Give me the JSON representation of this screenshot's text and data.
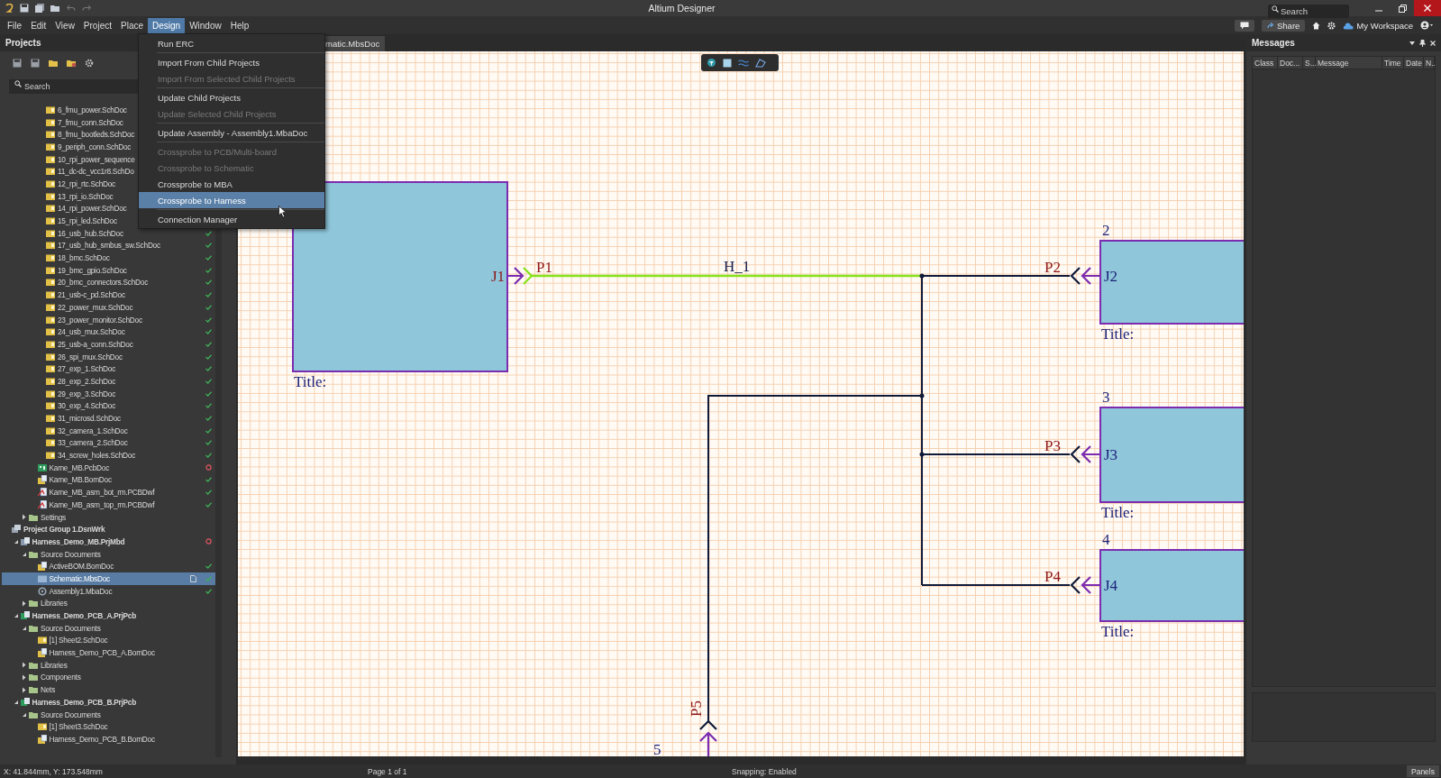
{
  "title_bar": {
    "title": "Altium Designer",
    "search_placeholder": "Search"
  },
  "menu_bar": {
    "menus": [
      {
        "label": "File",
        "selected": false
      },
      {
        "label": "Edit",
        "selected": false
      },
      {
        "label": "View",
        "selected": false
      },
      {
        "label": "Project",
        "selected": false
      },
      {
        "label": "Place",
        "selected": false
      },
      {
        "label": "Design",
        "selected": true
      },
      {
        "label": "Window",
        "selected": false
      },
      {
        "label": "Help",
        "selected": false
      }
    ],
    "share": "Share",
    "workspace": "My Workspace"
  },
  "design_menu": {
    "groups": [
      {
        "items": [
          {
            "label": "Run ERC",
            "disabled": false,
            "selected": false
          }
        ]
      },
      {
        "items": [
          {
            "label": "Import From Child Projects",
            "disabled": false,
            "selected": false
          },
          {
            "label": "Import From Selected Child Projects",
            "disabled": true,
            "selected": false
          }
        ]
      },
      {
        "items": [
          {
            "label": "Update Child Projects",
            "disabled": false,
            "selected": false
          },
          {
            "label": "Update Selected Child Projects",
            "disabled": true,
            "selected": false
          }
        ]
      },
      {
        "items": [
          {
            "label": "Update Assembly - Assembly1.MbaDoc",
            "disabled": false,
            "selected": false
          }
        ]
      },
      {
        "items": [
          {
            "label": "Crossprobe to PCB/Multi-board",
            "disabled": true,
            "selected": false
          },
          {
            "label": "Crossprobe to Schematic",
            "disabled": true,
            "selected": false
          },
          {
            "label": "Crossprobe to MBA",
            "disabled": false,
            "selected": false
          },
          {
            "label": "Crossprobe to Harness",
            "disabled": false,
            "selected": true
          }
        ]
      },
      {
        "items": [
          {
            "label": "Connection Manager",
            "disabled": false,
            "selected": false
          }
        ]
      }
    ]
  },
  "projects_panel": {
    "title": "Projects",
    "search_placeholder": "Search",
    "tree": [
      {
        "children": [
          {
            "children": [
              {
                "children": [
                  {
                    "children": [
                      {
                        "label": "6_fmu_power.SchDoc",
                        "kind": "sch",
                        "selected": false
                      },
                      {
                        "label": "7_fmu_conn.SchDoc",
                        "kind": "sch",
                        "selected": false
                      },
                      {
                        "label": "8_fmu_bootleds.SchDoc",
                        "kind": "sch",
                        "selected": false
                      },
                      {
                        "label": "9_periph_conn.SchDoc",
                        "kind": "sch",
                        "selected": false
                      },
                      {
                        "label": "10_rpi_power_sequence",
                        "kind": "sch",
                        "selected": false
                      },
                      {
                        "label": "11_dc-dc_vcc1r8.SchDo",
                        "kind": "sch",
                        "selected": false
                      },
                      {
                        "label": "12_rpi_rtc.SchDoc",
                        "kind": "sch",
                        "selected": false
                      },
                      {
                        "label": "13_rpi_io.SchDoc",
                        "kind": "sch",
                        "selected": false
                      },
                      {
                        "label": "14_rpi_power.SchDoc",
                        "kind": "sch",
                        "selected": false
                      },
                      {
                        "label": "15_rpi_led.SchDoc",
                        "kind": "sch",
                        "selected": false
                      },
                      {
                        "label": "16_usb_hub.SchDoc",
                        "kind": "sch",
                        "valid": true,
                        "selected": false
                      },
                      {
                        "label": "17_usb_hub_smbus_sw.SchDoc",
                        "kind": "sch",
                        "valid": true,
                        "selected": false
                      },
                      {
                        "label": "18_bmc.SchDoc",
                        "kind": "sch",
                        "valid": true,
                        "selected": false
                      },
                      {
                        "label": "19_bmc_gpio.SchDoc",
                        "kind": "sch",
                        "valid": true,
                        "selected": false
                      },
                      {
                        "label": "20_bmc_connectors.SchDoc",
                        "kind": "sch",
                        "valid": true,
                        "selected": false
                      },
                      {
                        "label": "21_usb-c_pd.SchDoc",
                        "kind": "sch",
                        "valid": true,
                        "selected": false
                      },
                      {
                        "label": "22_power_mux.SchDoc",
                        "kind": "sch",
                        "valid": true,
                        "selected": false
                      },
                      {
                        "label": "23_power_monitor.SchDoc",
                        "kind": "sch",
                        "valid": true,
                        "selected": false
                      },
                      {
                        "label": "24_usb_mux.SchDoc",
                        "kind": "sch",
                        "valid": true,
                        "selected": false
                      },
                      {
                        "label": "25_usb-a_conn.SchDoc",
                        "kind": "sch",
                        "valid": true,
                        "selected": false
                      },
                      {
                        "label": "26_spi_mux.SchDoc",
                        "kind": "sch",
                        "valid": true,
                        "selected": false
                      },
                      {
                        "label": "27_exp_1.SchDoc",
                        "kind": "sch",
                        "valid": true,
                        "selected": false
                      },
                      {
                        "label": "28_exp_2.SchDoc",
                        "kind": "sch",
                        "valid": true,
                        "selected": false
                      },
                      {
                        "label": "29_exp_3.SchDoc",
                        "kind": "sch",
                        "valid": true,
                        "selected": false
                      },
                      {
                        "label": "30_exp_4.SchDoc",
                        "kind": "sch",
                        "valid": true,
                        "selected": false
                      },
                      {
                        "label": "31_microsd.SchDoc",
                        "kind": "sch",
                        "valid": true,
                        "selected": false
                      },
                      {
                        "label": "32_camera_1.SchDoc",
                        "kind": "sch",
                        "valid": true,
                        "selected": false
                      },
                      {
                        "label": "33_camera_2.SchDoc",
                        "kind": "sch",
                        "valid": true,
                        "selected": false
                      },
                      {
                        "label": "34_screw_holes.SchDoc",
                        "kind": "sch",
                        "valid": true,
                        "selected": false
                      }
                    ]
                  },
                  {
                    "label": "Kame_MB.PcbDoc",
                    "kind": "pcb",
                    "valid": false,
                    "selected": false
                  },
                  {
                    "label": "Kame_MB.BomDoc",
                    "kind": "bom",
                    "valid": true,
                    "selected": false
                  },
                  {
                    "label": "Kame_MB_asm_bot_rm.PCBDwf",
                    "kind": "dwf",
                    "valid": true,
                    "selected": false
                  },
                  {
                    "label": "Kame_MB_asm_top_rm.PCBDwf",
                    "kind": "dwf",
                    "valid": true,
                    "selected": false
                  }
                ]
              },
              {
                "label": "Settings",
                "kind": "folder",
                "expanded": false,
                "selected": false
              }
            ]
          }
        ]
      },
      {
        "label": "Project Group 1.DsnWrk",
        "kind": "group",
        "selected": false,
        "children": [
          {
            "label": "Harness_Demo_MB.PrjMbd",
            "kind": "prjmbd",
            "expanded": true,
            "valid": false,
            "selected": false,
            "children": [
              {
                "label": "Source Documents",
                "kind": "folder",
                "expanded": true,
                "selected": false,
                "children": [
                  {
                    "label": "ActiveBOM.BomDoc",
                    "kind": "bom",
                    "valid": true,
                    "selected": false
                  },
                  {
                    "label": "Schematic.MbsDoc",
                    "kind": "mbs",
                    "valid": true,
                    "open": true,
                    "selected": true
                  },
                  {
                    "label": "Assembly1.MbaDoc",
                    "kind": "mba",
                    "valid": true,
                    "selected": false
                  }
                ]
              },
              {
                "label": "Libraries",
                "kind": "folder",
                "expanded": false,
                "selected": false
              }
            ]
          },
          {
            "label": "Harness_Demo_PCB_A.PrjPcb",
            "kind": "prjpcb",
            "expanded": true,
            "selected": false,
            "children": [
              {
                "label": "Source Documents",
                "kind": "folder",
                "expanded": true,
                "selected": false,
                "children": [
                  {
                    "label": "[1] Sheet2.SchDoc",
                    "kind": "sch",
                    "selected": false
                  },
                  {
                    "label": "Harness_Demo_PCB_A.BomDoc",
                    "kind": "bom",
                    "selected": false
                  }
                ]
              },
              {
                "label": "Libraries",
                "kind": "folder",
                "expanded": false,
                "selected": false
              },
              {
                "label": "Components",
                "kind": "folder",
                "expanded": false,
                "selected": false
              },
              {
                "label": "Nets",
                "kind": "folder",
                "expanded": false,
                "selected": false
              }
            ]
          },
          {
            "label": "Harness_Demo_PCB_B.PrjPcb",
            "kind": "prjpcb",
            "expanded": true,
            "selected": false,
            "children": [
              {
                "label": "Source Documents",
                "kind": "folder",
                "expanded": true,
                "selected": false,
                "children": [
                  {
                    "label": "[1] Sheet3.SchDoc",
                    "kind": "sch",
                    "selected": false
                  },
                  {
                    "label": "Harness_Demo_PCB_B.BomDoc",
                    "kind": "bom",
                    "selected": false
                  }
                ]
              }
            ]
          }
        ]
      }
    ]
  },
  "document_tab": {
    "label": "matic.MbsDoc"
  },
  "schematic": {
    "net_label": "H_1",
    "sheets": [
      {
        "designator": "J1",
        "port": "P1",
        "title": "Title:"
      },
      {
        "number": "2",
        "designator": "J2",
        "port": "P2",
        "title": "Title:"
      },
      {
        "number": "3",
        "designator": "J3",
        "port": "P3",
        "title": "Title:"
      },
      {
        "number": "4",
        "designator": "J4",
        "port": "P4",
        "title": "Title:"
      }
    ],
    "bottom_port": {
      "port": "P5",
      "number": "5"
    }
  },
  "messages_panel": {
    "title": "Messages",
    "columns": [
      "Class",
      "Doc...",
      "S...",
      "Message",
      "Time",
      "Date",
      "N.."
    ]
  },
  "status_bar": {
    "coordinates": "X: 41.844mm, Y: 173.548mm",
    "page": "Page 1 of 1",
    "snapping": "Snapping: Enabled",
    "panels_button": "Panels"
  }
}
